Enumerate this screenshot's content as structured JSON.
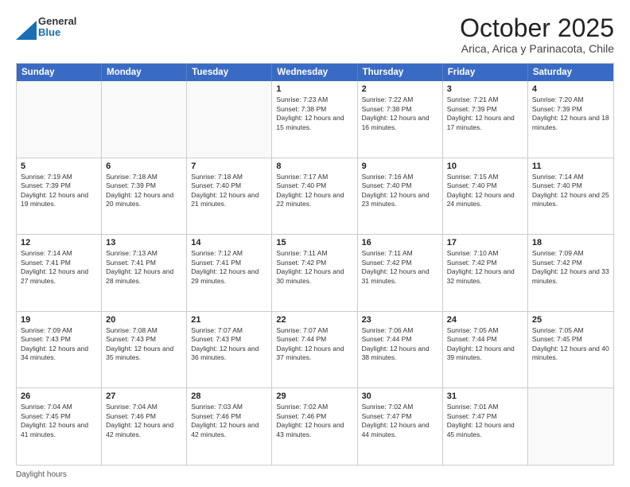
{
  "header": {
    "logo": {
      "general": "General",
      "blue": "Blue"
    },
    "title": "October 2025",
    "subtitle": "Arica, Arica y Parinacota, Chile"
  },
  "calendar": {
    "days": [
      "Sunday",
      "Monday",
      "Tuesday",
      "Wednesday",
      "Thursday",
      "Friday",
      "Saturday"
    ],
    "rows": [
      [
        {
          "day": "",
          "info": ""
        },
        {
          "day": "",
          "info": ""
        },
        {
          "day": "",
          "info": ""
        },
        {
          "day": "1",
          "info": "Sunrise: 7:23 AM\nSunset: 7:38 PM\nDaylight: 12 hours and 15 minutes."
        },
        {
          "day": "2",
          "info": "Sunrise: 7:22 AM\nSunset: 7:38 PM\nDaylight: 12 hours and 16 minutes."
        },
        {
          "day": "3",
          "info": "Sunrise: 7:21 AM\nSunset: 7:39 PM\nDaylight: 12 hours and 17 minutes."
        },
        {
          "day": "4",
          "info": "Sunrise: 7:20 AM\nSunset: 7:39 PM\nDaylight: 12 hours and 18 minutes."
        }
      ],
      [
        {
          "day": "5",
          "info": "Sunrise: 7:19 AM\nSunset: 7:39 PM\nDaylight: 12 hours and 19 minutes."
        },
        {
          "day": "6",
          "info": "Sunrise: 7:18 AM\nSunset: 7:39 PM\nDaylight: 12 hours and 20 minutes."
        },
        {
          "day": "7",
          "info": "Sunrise: 7:18 AM\nSunset: 7:40 PM\nDaylight: 12 hours and 21 minutes."
        },
        {
          "day": "8",
          "info": "Sunrise: 7:17 AM\nSunset: 7:40 PM\nDaylight: 12 hours and 22 minutes."
        },
        {
          "day": "9",
          "info": "Sunrise: 7:16 AM\nSunset: 7:40 PM\nDaylight: 12 hours and 23 minutes."
        },
        {
          "day": "10",
          "info": "Sunrise: 7:15 AM\nSunset: 7:40 PM\nDaylight: 12 hours and 24 minutes."
        },
        {
          "day": "11",
          "info": "Sunrise: 7:14 AM\nSunset: 7:40 PM\nDaylight: 12 hours and 25 minutes."
        }
      ],
      [
        {
          "day": "12",
          "info": "Sunrise: 7:14 AM\nSunset: 7:41 PM\nDaylight: 12 hours and 27 minutes."
        },
        {
          "day": "13",
          "info": "Sunrise: 7:13 AM\nSunset: 7:41 PM\nDaylight: 12 hours and 28 minutes."
        },
        {
          "day": "14",
          "info": "Sunrise: 7:12 AM\nSunset: 7:41 PM\nDaylight: 12 hours and 29 minutes."
        },
        {
          "day": "15",
          "info": "Sunrise: 7:11 AM\nSunset: 7:42 PM\nDaylight: 12 hours and 30 minutes."
        },
        {
          "day": "16",
          "info": "Sunrise: 7:11 AM\nSunset: 7:42 PM\nDaylight: 12 hours and 31 minutes."
        },
        {
          "day": "17",
          "info": "Sunrise: 7:10 AM\nSunset: 7:42 PM\nDaylight: 12 hours and 32 minutes."
        },
        {
          "day": "18",
          "info": "Sunrise: 7:09 AM\nSunset: 7:42 PM\nDaylight: 12 hours and 33 minutes."
        }
      ],
      [
        {
          "day": "19",
          "info": "Sunrise: 7:09 AM\nSunset: 7:43 PM\nDaylight: 12 hours and 34 minutes."
        },
        {
          "day": "20",
          "info": "Sunrise: 7:08 AM\nSunset: 7:43 PM\nDaylight: 12 hours and 35 minutes."
        },
        {
          "day": "21",
          "info": "Sunrise: 7:07 AM\nSunset: 7:43 PM\nDaylight: 12 hours and 36 minutes."
        },
        {
          "day": "22",
          "info": "Sunrise: 7:07 AM\nSunset: 7:44 PM\nDaylight: 12 hours and 37 minutes."
        },
        {
          "day": "23",
          "info": "Sunrise: 7:06 AM\nSunset: 7:44 PM\nDaylight: 12 hours and 38 minutes."
        },
        {
          "day": "24",
          "info": "Sunrise: 7:05 AM\nSunset: 7:44 PM\nDaylight: 12 hours and 39 minutes."
        },
        {
          "day": "25",
          "info": "Sunrise: 7:05 AM\nSunset: 7:45 PM\nDaylight: 12 hours and 40 minutes."
        }
      ],
      [
        {
          "day": "26",
          "info": "Sunrise: 7:04 AM\nSunset: 7:45 PM\nDaylight: 12 hours and 41 minutes."
        },
        {
          "day": "27",
          "info": "Sunrise: 7:04 AM\nSunset: 7:46 PM\nDaylight: 12 hours and 42 minutes."
        },
        {
          "day": "28",
          "info": "Sunrise: 7:03 AM\nSunset: 7:46 PM\nDaylight: 12 hours and 42 minutes."
        },
        {
          "day": "29",
          "info": "Sunrise: 7:02 AM\nSunset: 7:46 PM\nDaylight: 12 hours and 43 minutes."
        },
        {
          "day": "30",
          "info": "Sunrise: 7:02 AM\nSunset: 7:47 PM\nDaylight: 12 hours and 44 minutes."
        },
        {
          "day": "31",
          "info": "Sunrise: 7:01 AM\nSunset: 7:47 PM\nDaylight: 12 hours and 45 minutes."
        },
        {
          "day": "",
          "info": ""
        }
      ]
    ]
  },
  "footer": {
    "daylight_label": "Daylight hours"
  }
}
